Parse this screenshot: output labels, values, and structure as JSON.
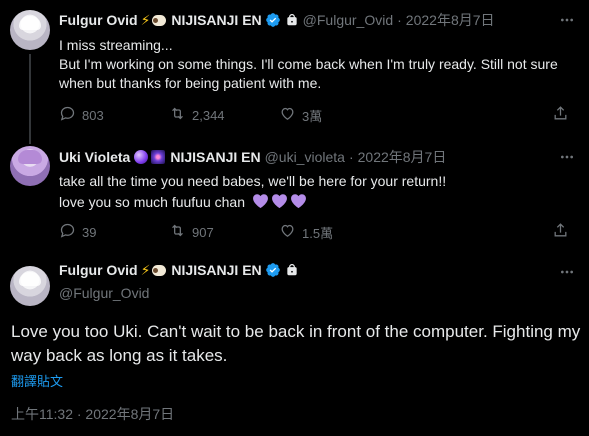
{
  "colors": {
    "background": "#000000",
    "text": "#e7e9ea",
    "secondary": "#71767b",
    "link": "#1d9bf0",
    "verified": "#1d9bf0",
    "heart_purple": "#b48ce8"
  },
  "tweets": [
    {
      "name": "Fulgur Ovid",
      "org": "NIJISANJI EN",
      "handle": "@Fulgur_Ovid",
      "separator": "·",
      "date": "2022年8月7日",
      "lines": [
        "I miss streaming...",
        "But I'm working on some things. I'll come back when I'm truly ready. Still not sure when but thanks for being patient with me."
      ],
      "replies": "803",
      "retweets": "2,344",
      "likes": "3萬",
      "icons": [
        "verified-badge-icon",
        "lock-icon",
        "more-icon",
        "reply-icon",
        "retweet-icon",
        "like-icon",
        "share-icon"
      ]
    },
    {
      "name": "Uki Violeta",
      "org": "NIJISANJI EN",
      "handle": "@uki_violeta",
      "separator": "·",
      "date": "2022年8月7日",
      "lines": [
        "take all the time you need babes, we'll be here for your return!!",
        "love you so much fuufuu chan"
      ],
      "replies": "39",
      "retweets": "907",
      "likes": "1.5萬",
      "icons": [
        "crystal-ball-icon",
        "galaxy-icon",
        "more-icon",
        "reply-icon",
        "retweet-icon",
        "like-icon",
        "share-icon"
      ]
    }
  ],
  "main_tweet": {
    "name": "Fulgur Ovid",
    "org": "NIJISANJI EN",
    "handle": "@Fulgur_Ovid",
    "text": "Love you too Uki. Can't wait to be back in front of the computer. Fighting my way back as long as it takes.",
    "translate": "翻譯貼文",
    "timestamp": "上午11:32 · 2022年8月7日"
  }
}
